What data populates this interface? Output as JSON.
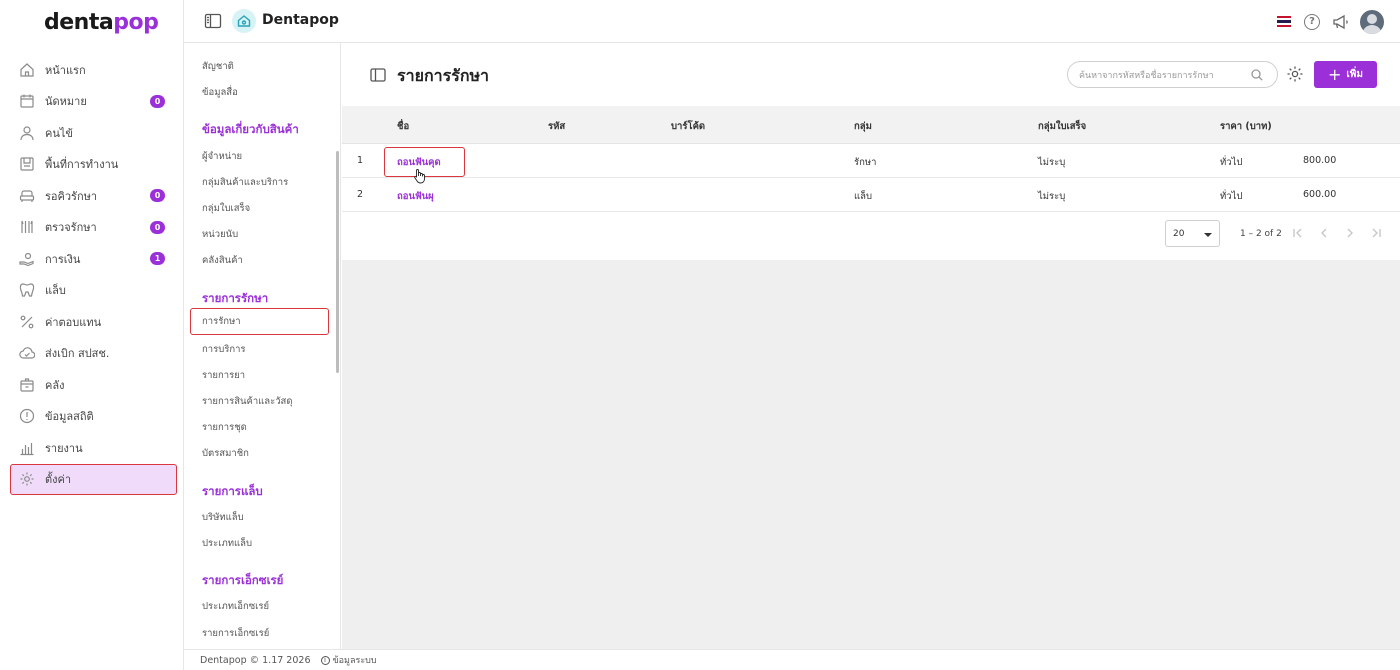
{
  "brand": {
    "logo_main": "denta",
    "logo_accent": "pop",
    "app_name": "Dentapop"
  },
  "sidebar": {
    "items": [
      {
        "label": "หน้าแรก",
        "icon": "home-icon"
      },
      {
        "label": "นัดหมาย",
        "icon": "calendar-icon",
        "badge": "0"
      },
      {
        "label": "คนไข้",
        "icon": "person-icon"
      },
      {
        "label": "พื้นที่การทำงาน",
        "icon": "workspace-icon"
      },
      {
        "label": "รอคิวรักษา",
        "icon": "sofa-icon",
        "badge": "0"
      },
      {
        "label": "ตรวจรักษา",
        "icon": "tools-icon",
        "badge": "0"
      },
      {
        "label": "การเงิน",
        "icon": "cash-icon",
        "badge": "1"
      },
      {
        "label": "แล็บ",
        "icon": "tooth-icon"
      },
      {
        "label": "ค่าตอบแทน",
        "icon": "percent-icon"
      },
      {
        "label": "ส่งเบิก สปสช.",
        "icon": "cloud-icon"
      },
      {
        "label": "คลัง",
        "icon": "box-icon"
      },
      {
        "label": "ข้อมูลสถิติ",
        "icon": "stats-icon"
      },
      {
        "label": "รายงาน",
        "icon": "report-icon"
      },
      {
        "label": "ตั้งค่า",
        "icon": "gear-icon"
      }
    ]
  },
  "subnav": {
    "top_items": [
      "สัญชาติ",
      "ข้อมูลสื่อ"
    ],
    "sections": [
      {
        "title": "ข้อมูลเกี่ยวกับสินค้า",
        "items": [
          "ผู้จำหน่าย",
          "กลุ่มสินค้าและบริการ",
          "กลุ่มใบเสร็จ",
          "หน่วยนับ",
          "คลังสินค้า"
        ]
      },
      {
        "title": "รายการรักษา",
        "items": [
          "การรักษา",
          "การบริการ",
          "รายการยา",
          "รายการสินค้าและวัสดุ",
          "รายการชุด",
          "บัตรสมาชิก"
        ]
      },
      {
        "title": "รายการแล็บ",
        "items": [
          "บริษัทแล็บ",
          "ประเภทแล็บ"
        ]
      },
      {
        "title": "รายการเอ็กซเรย์",
        "items": [
          "ประเภทเอ็กซเรย์",
          "รายการเอ็กซเรย์"
        ]
      }
    ]
  },
  "page": {
    "title": "รายการรักษา",
    "search_placeholder": "ค้นหาจากรหัสหรือชื่อรายการรักษา",
    "add_label": "เพิ่ม"
  },
  "table": {
    "columns": [
      "ชื่อ",
      "รหัส",
      "บาร์โค้ด",
      "กลุ่ม",
      "กลุ่มใบเสร็จ",
      "ราคา (บาท)"
    ],
    "rows": [
      {
        "no": "1",
        "name": "ถอนฟันคุด",
        "code": "",
        "barcode": "",
        "group": "รักษา",
        "receipt_group": "ไม่ระบุ",
        "price_type": "ทั่วไป",
        "price": "800.00"
      },
      {
        "no": "2",
        "name": "ถอนฟันผุ",
        "code": "",
        "barcode": "",
        "group": "แล็บ",
        "receipt_group": "ไม่ระบุ",
        "price_type": "ทั่วไป",
        "price": "600.00"
      }
    ]
  },
  "pager": {
    "page_size": "20",
    "range": "1 – 2 of 2"
  },
  "footer": {
    "version": "Dentapop © 1.17 2026",
    "info": "ข้อมูลระบบ"
  },
  "colors": {
    "accent": "#9b30d9",
    "highlight_border": "#d9363e",
    "active_bg": "#f0dcfa"
  }
}
